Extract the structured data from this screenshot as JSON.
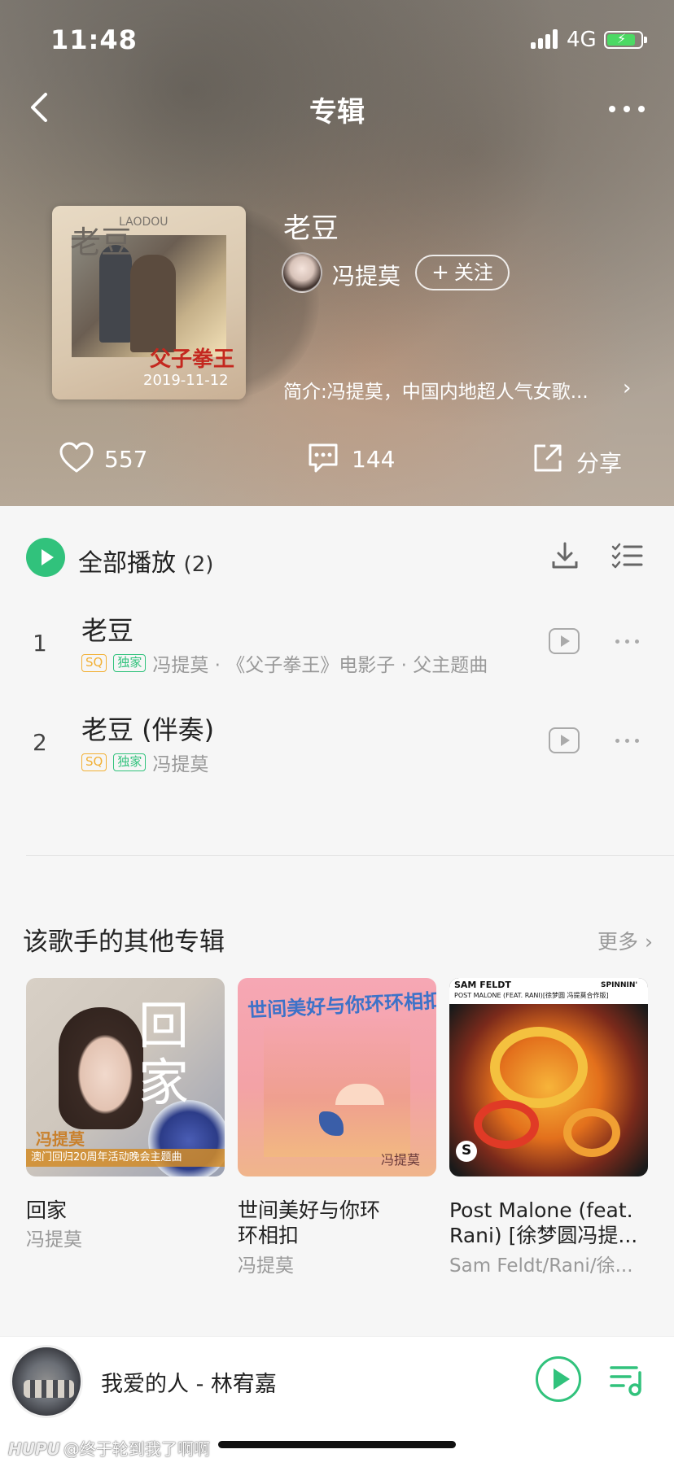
{
  "status_bar": {
    "time": "11:48",
    "network": "4G"
  },
  "nav": {
    "title": "专辑"
  },
  "album": {
    "cover": {
      "title": "老豆",
      "subtitle": "LAODOU",
      "film": "父子拳王",
      "date": "2019-11-12"
    },
    "title": "老豆",
    "artist": "冯提莫",
    "follow_label": "关注",
    "intro": "简介:冯提莫，中国内地超人气女歌..."
  },
  "stats": {
    "likes": "557",
    "comments": "144",
    "share_label": "分享"
  },
  "track_list": {
    "play_all_label": "全部播放",
    "count": "(2)",
    "tracks": [
      {
        "index": "1",
        "name": "老豆",
        "tags": [
          "SQ",
          "独家"
        ],
        "subtitle": "冯提莫 · 《父子拳王》电影子 · 父主题曲"
      },
      {
        "index": "2",
        "name": "老豆 (伴奏)",
        "tags": [
          "SQ",
          "独家"
        ],
        "subtitle": "冯提莫"
      }
    ]
  },
  "other_albums": {
    "title": "该歌手的其他专辑",
    "more_label": "更多",
    "albums": [
      {
        "title": "回家",
        "artist": "冯提莫",
        "art_text": "回家",
        "art_name": "冯提莫",
        "art_band": "澳门回归20周年活动晚会主题曲"
      },
      {
        "title": "世间美好与你环环相扣",
        "artist": "冯提莫",
        "art_text": "世间美好与你环环相扣",
        "art_sign": "冯提莫"
      },
      {
        "title": "Post Malone (feat. Rani) [徐梦圆冯提...",
        "artist": "Sam Feldt/Rani/徐...",
        "art_header": "SAM FELDT",
        "art_sub": "POST MALONE (FEAT. RANI)[徐梦圆 冯提莫合作版]",
        "art_label": "SPINNIN'"
      }
    ]
  },
  "player": {
    "now_playing": "我爱的人 - 林宥嘉"
  },
  "watermark": {
    "brand": "HUPU",
    "text": "@终于轮到我了啊啊"
  },
  "colors": {
    "accent": "#31c27c",
    "sq_tag": "#f2b035"
  },
  "icons": [
    "back-icon",
    "more-icon",
    "heart-icon",
    "comment-icon",
    "share-icon",
    "download-icon",
    "multi-select-icon",
    "mv-icon",
    "playlist-icon"
  ]
}
